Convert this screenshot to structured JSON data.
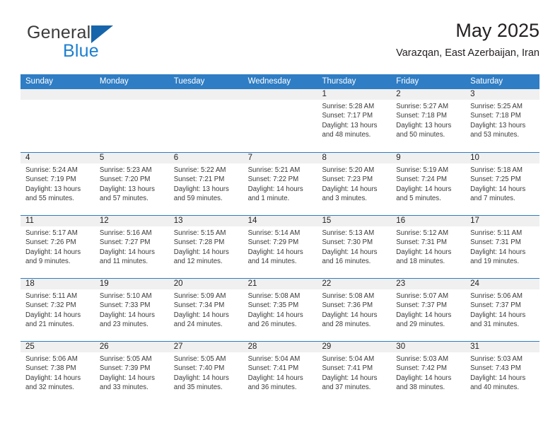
{
  "brand": {
    "word1": "General",
    "word2": "Blue",
    "triangle_color": "#1665ab",
    "blue_color": "#1c7fd1"
  },
  "header": {
    "month_title": "May 2025",
    "location": "Varazqan, East Azerbaijan, Iran"
  },
  "theme": {
    "header_blue": "#2f7dc4",
    "date_strip_gray": "#f0f0f0"
  },
  "weekdays": [
    "Sunday",
    "Monday",
    "Tuesday",
    "Wednesday",
    "Thursday",
    "Friday",
    "Saturday"
  ],
  "weeks": [
    [
      {
        "day": "",
        "lines": []
      },
      {
        "day": "",
        "lines": []
      },
      {
        "day": "",
        "lines": []
      },
      {
        "day": "",
        "lines": []
      },
      {
        "day": "1",
        "lines": [
          "Sunrise: 5:28 AM",
          "Sunset: 7:17 PM",
          "Daylight: 13 hours",
          "and 48 minutes."
        ]
      },
      {
        "day": "2",
        "lines": [
          "Sunrise: 5:27 AM",
          "Sunset: 7:18 PM",
          "Daylight: 13 hours",
          "and 50 minutes."
        ]
      },
      {
        "day": "3",
        "lines": [
          "Sunrise: 5:25 AM",
          "Sunset: 7:18 PM",
          "Daylight: 13 hours",
          "and 53 minutes."
        ]
      }
    ],
    [
      {
        "day": "4",
        "lines": [
          "Sunrise: 5:24 AM",
          "Sunset: 7:19 PM",
          "Daylight: 13 hours",
          "and 55 minutes."
        ]
      },
      {
        "day": "5",
        "lines": [
          "Sunrise: 5:23 AM",
          "Sunset: 7:20 PM",
          "Daylight: 13 hours",
          "and 57 minutes."
        ]
      },
      {
        "day": "6",
        "lines": [
          "Sunrise: 5:22 AM",
          "Sunset: 7:21 PM",
          "Daylight: 13 hours",
          "and 59 minutes."
        ]
      },
      {
        "day": "7",
        "lines": [
          "Sunrise: 5:21 AM",
          "Sunset: 7:22 PM",
          "Daylight: 14 hours",
          "and 1 minute."
        ]
      },
      {
        "day": "8",
        "lines": [
          "Sunrise: 5:20 AM",
          "Sunset: 7:23 PM",
          "Daylight: 14 hours",
          "and 3 minutes."
        ]
      },
      {
        "day": "9",
        "lines": [
          "Sunrise: 5:19 AM",
          "Sunset: 7:24 PM",
          "Daylight: 14 hours",
          "and 5 minutes."
        ]
      },
      {
        "day": "10",
        "lines": [
          "Sunrise: 5:18 AM",
          "Sunset: 7:25 PM",
          "Daylight: 14 hours",
          "and 7 minutes."
        ]
      }
    ],
    [
      {
        "day": "11",
        "lines": [
          "Sunrise: 5:17 AM",
          "Sunset: 7:26 PM",
          "Daylight: 14 hours",
          "and 9 minutes."
        ]
      },
      {
        "day": "12",
        "lines": [
          "Sunrise: 5:16 AM",
          "Sunset: 7:27 PM",
          "Daylight: 14 hours",
          "and 11 minutes."
        ]
      },
      {
        "day": "13",
        "lines": [
          "Sunrise: 5:15 AM",
          "Sunset: 7:28 PM",
          "Daylight: 14 hours",
          "and 12 minutes."
        ]
      },
      {
        "day": "14",
        "lines": [
          "Sunrise: 5:14 AM",
          "Sunset: 7:29 PM",
          "Daylight: 14 hours",
          "and 14 minutes."
        ]
      },
      {
        "day": "15",
        "lines": [
          "Sunrise: 5:13 AM",
          "Sunset: 7:30 PM",
          "Daylight: 14 hours",
          "and 16 minutes."
        ]
      },
      {
        "day": "16",
        "lines": [
          "Sunrise: 5:12 AM",
          "Sunset: 7:31 PM",
          "Daylight: 14 hours",
          "and 18 minutes."
        ]
      },
      {
        "day": "17",
        "lines": [
          "Sunrise: 5:11 AM",
          "Sunset: 7:31 PM",
          "Daylight: 14 hours",
          "and 19 minutes."
        ]
      }
    ],
    [
      {
        "day": "18",
        "lines": [
          "Sunrise: 5:11 AM",
          "Sunset: 7:32 PM",
          "Daylight: 14 hours",
          "and 21 minutes."
        ]
      },
      {
        "day": "19",
        "lines": [
          "Sunrise: 5:10 AM",
          "Sunset: 7:33 PM",
          "Daylight: 14 hours",
          "and 23 minutes."
        ]
      },
      {
        "day": "20",
        "lines": [
          "Sunrise: 5:09 AM",
          "Sunset: 7:34 PM",
          "Daylight: 14 hours",
          "and 24 minutes."
        ]
      },
      {
        "day": "21",
        "lines": [
          "Sunrise: 5:08 AM",
          "Sunset: 7:35 PM",
          "Daylight: 14 hours",
          "and 26 minutes."
        ]
      },
      {
        "day": "22",
        "lines": [
          "Sunrise: 5:08 AM",
          "Sunset: 7:36 PM",
          "Daylight: 14 hours",
          "and 28 minutes."
        ]
      },
      {
        "day": "23",
        "lines": [
          "Sunrise: 5:07 AM",
          "Sunset: 7:37 PM",
          "Daylight: 14 hours",
          "and 29 minutes."
        ]
      },
      {
        "day": "24",
        "lines": [
          "Sunrise: 5:06 AM",
          "Sunset: 7:37 PM",
          "Daylight: 14 hours",
          "and 31 minutes."
        ]
      }
    ],
    [
      {
        "day": "25",
        "lines": [
          "Sunrise: 5:06 AM",
          "Sunset: 7:38 PM",
          "Daylight: 14 hours",
          "and 32 minutes."
        ]
      },
      {
        "day": "26",
        "lines": [
          "Sunrise: 5:05 AM",
          "Sunset: 7:39 PM",
          "Daylight: 14 hours",
          "and 33 minutes."
        ]
      },
      {
        "day": "27",
        "lines": [
          "Sunrise: 5:05 AM",
          "Sunset: 7:40 PM",
          "Daylight: 14 hours",
          "and 35 minutes."
        ]
      },
      {
        "day": "28",
        "lines": [
          "Sunrise: 5:04 AM",
          "Sunset: 7:41 PM",
          "Daylight: 14 hours",
          "and 36 minutes."
        ]
      },
      {
        "day": "29",
        "lines": [
          "Sunrise: 5:04 AM",
          "Sunset: 7:41 PM",
          "Daylight: 14 hours",
          "and 37 minutes."
        ]
      },
      {
        "day": "30",
        "lines": [
          "Sunrise: 5:03 AM",
          "Sunset: 7:42 PM",
          "Daylight: 14 hours",
          "and 38 minutes."
        ]
      },
      {
        "day": "31",
        "lines": [
          "Sunrise: 5:03 AM",
          "Sunset: 7:43 PM",
          "Daylight: 14 hours",
          "and 40 minutes."
        ]
      }
    ]
  ]
}
